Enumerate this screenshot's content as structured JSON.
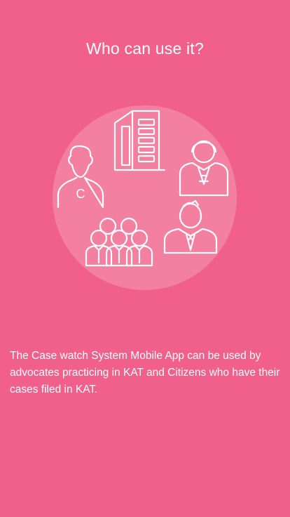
{
  "screen": {
    "title": "Who can use it?",
    "description": "The Case watch System Mobile App can be used by advocates practicing in KAT and Citizens who have their cases filed in KAT.",
    "citizen_badge_letter": "C"
  },
  "colors": {
    "background": "#f0608a",
    "circle": "rgba(255,255,255,0.2)",
    "stroke": "#ffffff"
  },
  "icons": [
    "citizen-icon",
    "court-building-icon",
    "judge-icon",
    "advocate-icon",
    "group-of-people-icon"
  ]
}
